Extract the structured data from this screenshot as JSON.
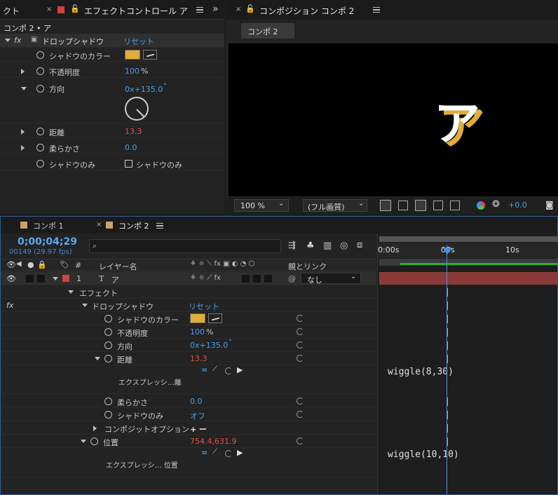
{
  "effect_panel": {
    "tab_left": "クト",
    "tab_title": "エフェクトコントロール ア",
    "breadcrumb": "コンポ 2 • ア",
    "fx_label": "fx",
    "effect_name": "ドロップシャドウ",
    "reset": "リセット",
    "rows": {
      "shadow_color": "シャドウのカラー",
      "opacity": "不透明度",
      "opacity_value": "100",
      "opacity_unit": "%",
      "direction": "方向",
      "direction_value": "0x+135.0",
      "direction_unit": "°",
      "distance": "距離",
      "distance_value": "13.3",
      "softness": "柔らかさ",
      "softness_value": "0.0",
      "shadow_only": "シャドウのみ",
      "shadow_only_checkbox": "シャドウのみ"
    },
    "colors": {
      "shadow": "#e0ad3a",
      "accent": "#4a9ee8",
      "animated": "#e0504a"
    }
  },
  "comp_panel": {
    "tab_title": "コンポジション コンポ 2",
    "sub_tab": "コンポ 2",
    "preview_glyph": "ア",
    "zoom": "100 %",
    "resolution": "(フル画質)",
    "exposure": "+0.0"
  },
  "timeline": {
    "tab1": "コンポ 1",
    "tab2": "コンポ 2",
    "timecode": "0;00;04;29",
    "frame_info": "00149 (29.97 fps)",
    "search_placeholder": "",
    "col_hash": "#",
    "col_layer_name": "レイヤー名",
    "col_parent": "親とリンク",
    "ruler": [
      "0:00s",
      "05s",
      "10s"
    ],
    "layer": {
      "index": "1",
      "type_icon": "T",
      "name": "ア",
      "parent": "なし"
    },
    "rows": {
      "effects": "エフェクト",
      "fx": "fx",
      "drop_shadow": "ドロップシャドウ",
      "reset": "リセット",
      "shadow_color": "シャドウのカラー",
      "opacity": "不透明度",
      "opacity_value": "100",
      "opacity_unit": "%",
      "direction": "方向",
      "direction_value": "0x+135.0",
      "direction_unit": "°",
      "distance": "距離",
      "distance_value": "13.3",
      "expression_label_1": "エクスプレッシ…離",
      "expression_1": "wiggle(8,30)",
      "softness": "柔らかさ",
      "softness_value": "0.0",
      "shadow_only": "シャドウのみ",
      "shadow_only_value": "オフ",
      "composite_options": "コンポジットオプション",
      "composite_value": "+ ー",
      "position": "位置",
      "position_value": "754.4,631.9",
      "expression_label_2": "エクスプレッシ… 位置",
      "expression_2": "wiggle(10,10)"
    }
  }
}
